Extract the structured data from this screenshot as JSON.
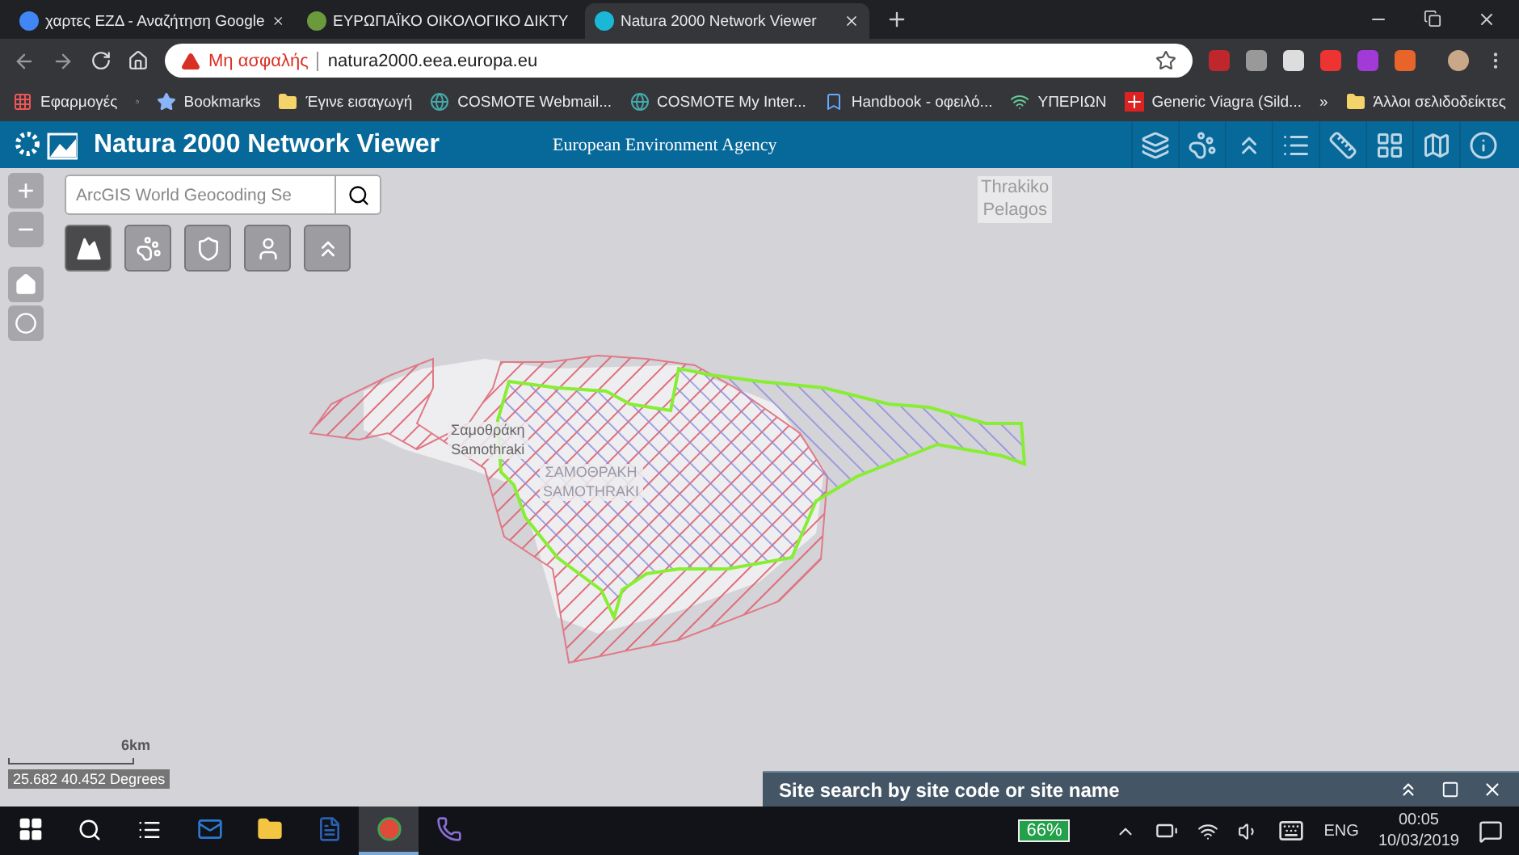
{
  "browser": {
    "tabs": [
      {
        "title": "χαρτες ΕΖΔ - Αναζήτηση Google",
        "selected": false
      },
      {
        "title": "ΕΥΡΩΠΑΪΚΟ ΟΙΚΟΛΟΓΙΚΟ ΔΙΚΤΥ",
        "selected": false
      },
      {
        "title": "Natura 2000 Network Viewer",
        "selected": true
      }
    ],
    "address": {
      "warning": "Μη ασφαλής",
      "url": "natura2000.eea.europa.eu"
    },
    "bookmarks": [
      "Εφαρμογές",
      "Bookmarks",
      "Έγινε εισαγωγή",
      "COSMOTE Webmail...",
      "COSMOTE My Inter...",
      "Handbook - οφειλό...",
      "ΥΠΕΡΙΩΝ",
      "Generic Viagra (Sild..."
    ],
    "overflow": "»",
    "other_bookmarks": "Άλλοι σελιδοδείκτες"
  },
  "app": {
    "title": "Natura 2000 Network Viewer",
    "agency": "European Environment Agency"
  },
  "map": {
    "zoom_in": "+",
    "zoom_out": "−",
    "search": {
      "placeholder": "ArcGIS World Geocoding Se"
    },
    "layer_buttons": [
      {
        "selected": true
      },
      {
        "selected": false
      },
      {
        "selected": false
      },
      {
        "selected": false
      },
      {
        "selected": false
      }
    ],
    "labels": [
      {
        "kind": "sea",
        "lines": [
          "Thrakiko",
          "Pelagos"
        ]
      },
      {
        "kind": "town",
        "lines": [
          "Σαμοθράκη",
          "Samothraki"
        ]
      },
      {
        "kind": "area",
        "lines": [
          "ΣΑΜΟΘΡΑΚΗ",
          "SAMOTHRAKI"
        ]
      }
    ],
    "scale": "6km",
    "coordinates": "25.682 40.452 Degrees"
  },
  "panel": {
    "title": "Site search by site code or site name"
  },
  "taskbar": {
    "apps": [
      {
        "kind": "mail",
        "selected": false
      },
      {
        "kind": "folder",
        "selected": false
      },
      {
        "kind": "word",
        "selected": false
      },
      {
        "kind": "chrome",
        "selected": true
      },
      {
        "kind": "viber",
        "selected": false
      }
    ],
    "battery": "66%",
    "language": "ENG",
    "time": "00:05",
    "date": "10/03/2019"
  }
}
